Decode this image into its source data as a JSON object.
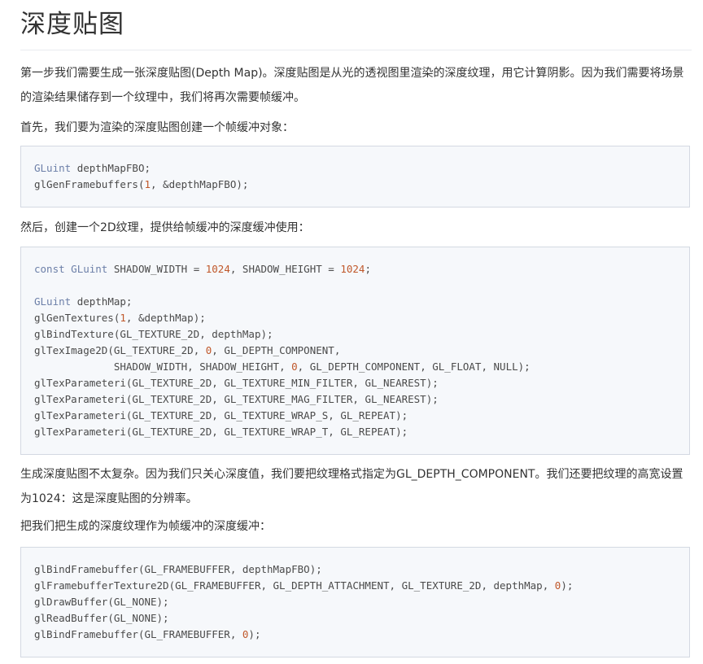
{
  "title": "深度贴图",
  "paragraphs": [
    "第一步我们需要生成一张深度贴图(Depth Map)。深度贴图是从光的透视图里渲染的深度纹理，用它计算阴影。因为我们需要将场景的渲染结果储存到一个纹理中，我们将再次需要帧缓冲。",
    "首先，我们要为渲染的深度贴图创建一个帧缓冲对象：",
    "然后，创建一个2D纹理，提供给帧缓冲的深度缓冲使用：",
    "生成深度贴图不太复杂。因为我们只关心深度值，我们要把纹理格式指定为GL_DEPTH_COMPONENT。我们还要把纹理的高宽设置为1024：这是深度贴图的分辨率。",
    "把我们把生成的深度纹理作为帧缓冲的深度缓冲："
  ],
  "code1": [
    "GLuint depthMapFBO;",
    "glGenFramebuffers(1, &depthMapFBO);"
  ],
  "code2": [
    "const GLuint SHADOW_WIDTH = 1024, SHADOW_HEIGHT = 1024;",
    "",
    "GLuint depthMap;",
    "glGenTextures(1, &depthMap);",
    "glBindTexture(GL_TEXTURE_2D, depthMap);",
    "glTexImage2D(GL_TEXTURE_2D, 0, GL_DEPTH_COMPONENT,",
    "             SHADOW_WIDTH, SHADOW_HEIGHT, 0, GL_DEPTH_COMPONENT, GL_FLOAT, NULL);",
    "glTexParameteri(GL_TEXTURE_2D, GL_TEXTURE_MIN_FILTER, GL_NEAREST);",
    "glTexParameteri(GL_TEXTURE_2D, GL_TEXTURE_MAG_FILTER, GL_NEAREST);",
    "glTexParameteri(GL_TEXTURE_2D, GL_TEXTURE_WRAP_S, GL_REPEAT);",
    "glTexParameteri(GL_TEXTURE_2D, GL_TEXTURE_WRAP_T, GL_REPEAT);"
  ],
  "code3": [
    "glBindFramebuffer(GL_FRAMEBUFFER, depthMapFBO);",
    "glFramebufferTexture2D(GL_FRAMEBUFFER, GL_DEPTH_ATTACHMENT, GL_TEXTURE_2D, depthMap, 0);",
    "glDrawBuffer(GL_NONE);",
    "glReadBuffer(GL_NONE);",
    "glBindFramebuffer(GL_FRAMEBUFFER, 0);"
  ],
  "colors": {
    "keyword": "#6c7fa8",
    "number": "#c0582b",
    "code_bg": "#f6f8fb",
    "code_border": "#d4d9e2"
  }
}
